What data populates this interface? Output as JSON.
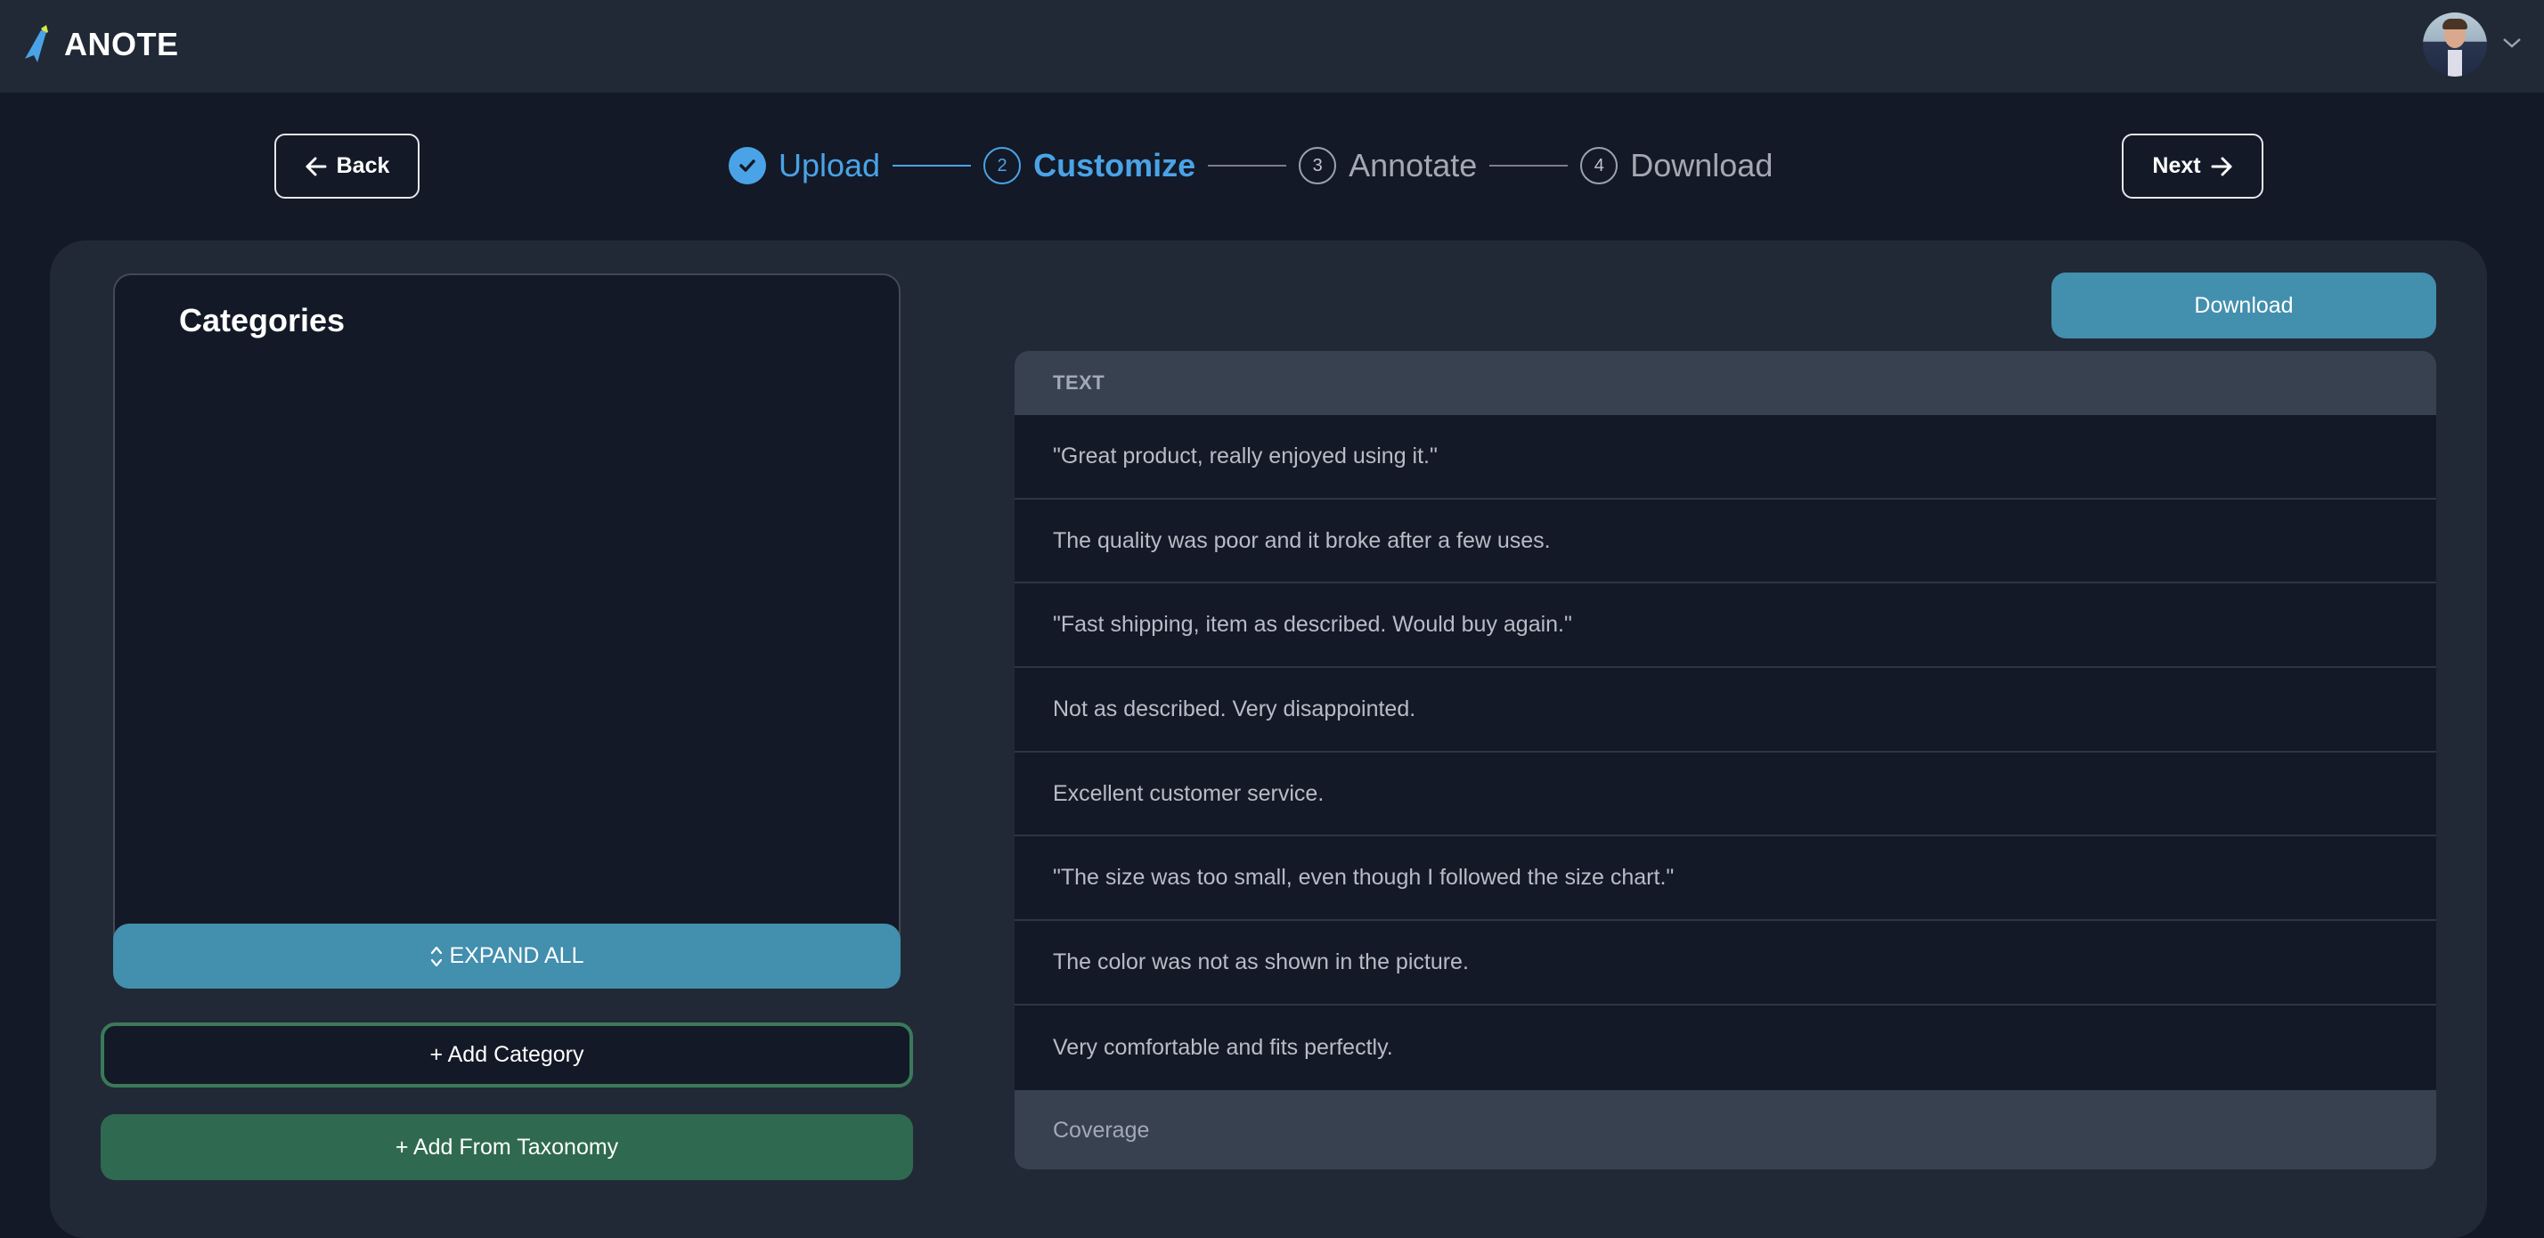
{
  "app": {
    "name": "ANOTE",
    "logo_icon": "pen-feather-icon",
    "avatar_icon": "user-avatar-photo",
    "avatar_menu_icon": "chevron-down-icon"
  },
  "nav": {
    "back_label": "Back",
    "next_label": "Next"
  },
  "stepper": {
    "steps": [
      {
        "number": "1",
        "label": "Upload",
        "state": "done"
      },
      {
        "number": "2",
        "label": "Customize",
        "state": "active"
      },
      {
        "number": "3",
        "label": "Annotate",
        "state": "pending"
      },
      {
        "number": "4",
        "label": "Download",
        "state": "pending"
      }
    ]
  },
  "categories": {
    "title": "Categories",
    "expand_all_label": "EXPAND ALL",
    "add_category_label": "+ Add Category",
    "add_from_taxonomy_label": "+ Add From Taxonomy",
    "items": []
  },
  "download_label": "Download",
  "table": {
    "column_header": "TEXT",
    "rows": [
      "\"Great product, really enjoyed using it.\"",
      "The quality was poor and it broke after a few uses.",
      "\"Fast shipping, item as described. Would buy again.\"",
      "Not as described. Very disappointed.",
      "Excellent customer service.",
      "\"The size was too small, even though I followed the size chart.\"",
      "The color was not as shown in the picture.",
      "Very comfortable and fits perfectly."
    ],
    "footer_label": "Coverage"
  },
  "colors": {
    "accent_blue": "#4aa3e6",
    "button_blue": "#428fae",
    "green": "#2f6a50",
    "green_border": "#3a7a5a",
    "background": "#131926",
    "panel": "#222936",
    "header": "#212836"
  }
}
